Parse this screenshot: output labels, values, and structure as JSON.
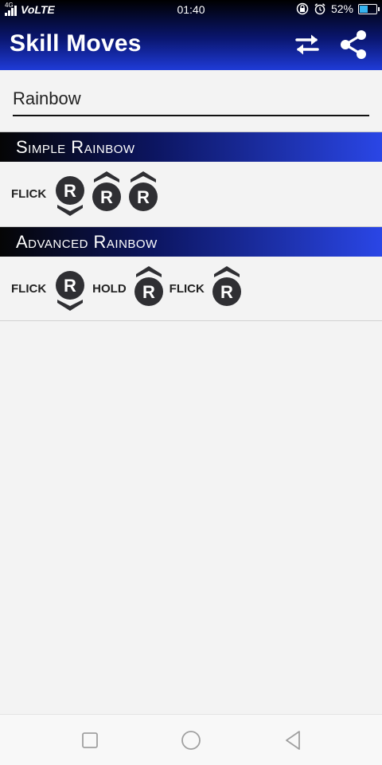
{
  "status": {
    "network_small": "4G",
    "carrier": "VoLTE",
    "time": "01:40",
    "battery_text": "52%",
    "battery_level": 0.52,
    "battery_color": "#36b4f0"
  },
  "appbar": {
    "title": "Skill Moves",
    "swap_icon": "swap-arrows-icon",
    "share_icon": "share-icon"
  },
  "search": {
    "value": "Rainbow",
    "placeholder": ""
  },
  "moves": [
    {
      "title": "Simple Rainbow",
      "steps": [
        {
          "type": "text",
          "label": "FLICK"
        },
        {
          "type": "stick",
          "letter": "R",
          "direction": "down"
        },
        {
          "type": "stick",
          "letter": "R",
          "direction": "up"
        },
        {
          "type": "stick",
          "letter": "R",
          "direction": "up"
        }
      ]
    },
    {
      "title": "Advanced Rainbow",
      "steps": [
        {
          "type": "text",
          "label": "FLICK"
        },
        {
          "type": "stick",
          "letter": "R",
          "direction": "down"
        },
        {
          "type": "text",
          "label": "HOLD"
        },
        {
          "type": "stick",
          "letter": "R",
          "direction": "up"
        },
        {
          "type": "text",
          "label": "FLICK"
        },
        {
          "type": "stick",
          "letter": "R",
          "direction": "up"
        }
      ]
    }
  ],
  "colors": {
    "header_gradient_end": "#2a46e6",
    "stick_fill": "#2f2f33"
  },
  "navbar": {
    "icons": [
      "recent-apps-icon",
      "home-icon",
      "back-icon"
    ]
  }
}
